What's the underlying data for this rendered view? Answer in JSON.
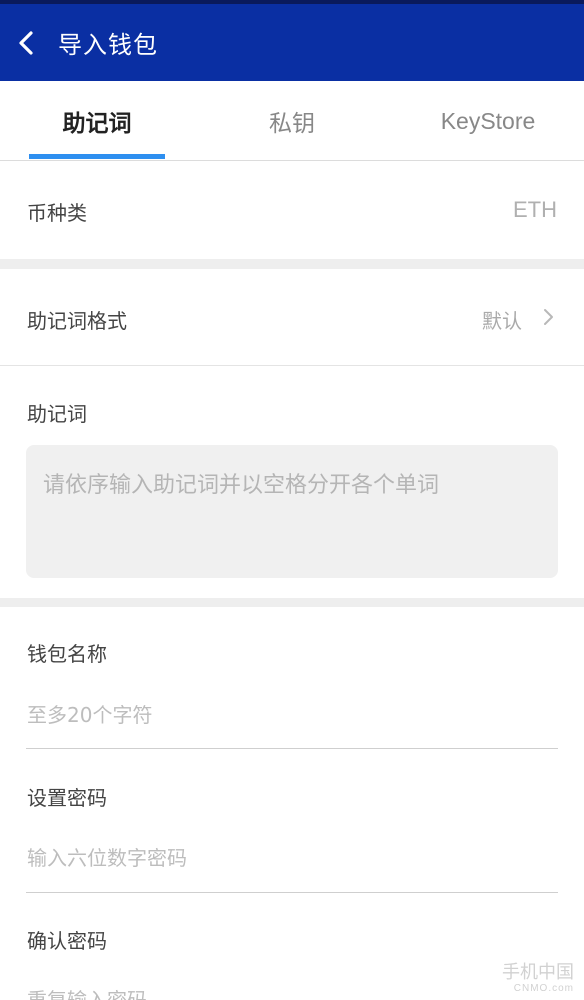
{
  "header": {
    "title": "导入钱包"
  },
  "tabs": [
    {
      "label": "助记词",
      "active": true
    },
    {
      "label": "私钥",
      "active": false
    },
    {
      "label": "KeyStore",
      "active": false
    }
  ],
  "coin": {
    "label": "币种类",
    "value": "ETH"
  },
  "mnemonic_format": {
    "label": "助记词格式",
    "value": "默认"
  },
  "mnemonic": {
    "label": "助记词",
    "placeholder": "请依序输入助记词并以空格分开各个单词"
  },
  "wallet_name": {
    "label": "钱包名称",
    "placeholder": "至多20个字符"
  },
  "password": {
    "label": "设置密码",
    "placeholder": "输入六位数字密码"
  },
  "confirm_password": {
    "label": "确认密码",
    "placeholder": "重复输入密码"
  },
  "watermark": {
    "text": "手机中国",
    "sub": "CNMO.com"
  },
  "colors": {
    "app_bar": "#0a2fa3",
    "accent": "#2e8ff0"
  }
}
